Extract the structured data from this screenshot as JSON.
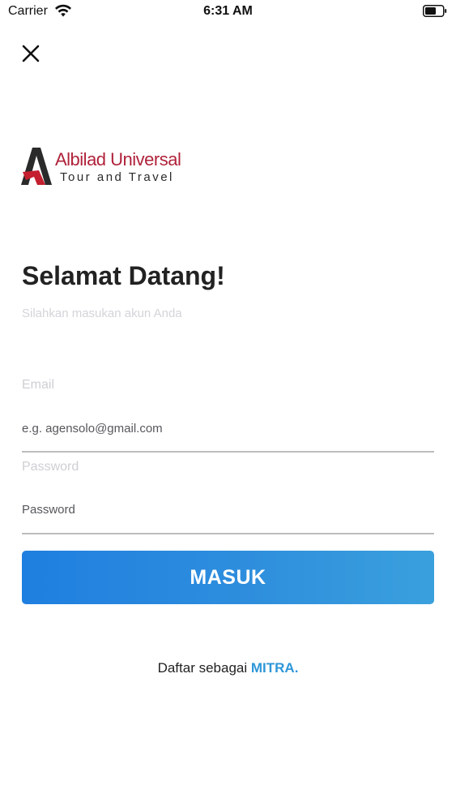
{
  "status_bar": {
    "carrier": "Carrier",
    "time": "6:31 AM",
    "icons": [
      "wifi-icon",
      "battery-icon"
    ]
  },
  "header": {
    "close_icon": "close-icon"
  },
  "logo": {
    "name": "Albilad Universal",
    "tagline": "Tour and Travel",
    "brand_color": "#b0223a"
  },
  "welcome": {
    "title": "Selamat Datang!",
    "subtitle": "Silahkan masukan akun Anda"
  },
  "form": {
    "email": {
      "label": "Email",
      "placeholder": "e.g. agensolo@gmail.com",
      "value": ""
    },
    "password": {
      "label": "Password",
      "placeholder": "Password",
      "value": ""
    },
    "submit_label": "MASUK"
  },
  "footer": {
    "register_text": "Daftar sebagai ",
    "register_link": "MITRA."
  },
  "colors": {
    "accent": "#2e8edd",
    "link": "#2e97d8"
  }
}
